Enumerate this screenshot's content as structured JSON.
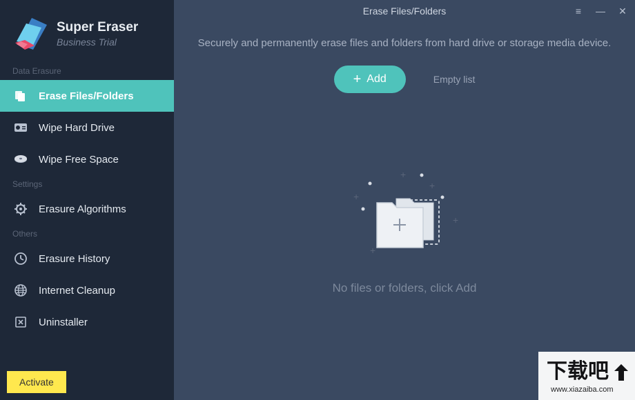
{
  "brand": {
    "title": "Super Eraser",
    "subtitle": "Business Trial"
  },
  "sections": {
    "data_erasure": "Data Erasure",
    "settings": "Settings",
    "others": "Others"
  },
  "nav": {
    "erase_files": "Erase Files/Folders",
    "wipe_drive": "Wipe Hard Drive",
    "wipe_free": "Wipe Free Space",
    "algorithms": "Erasure Algorithms",
    "history": "Erasure History",
    "internet": "Internet Cleanup",
    "uninstaller": "Uninstaller"
  },
  "activate": "Activate",
  "header": {
    "title": "Erase Files/Folders",
    "subtitle": "Securely and permanently erase files and folders from hard drive or storage media device."
  },
  "actions": {
    "add": "Add",
    "empty": "Empty list"
  },
  "empty_state": "No files or folders, click Add",
  "watermark": {
    "text": "下载吧",
    "url": "www.xiazaiba.com"
  }
}
